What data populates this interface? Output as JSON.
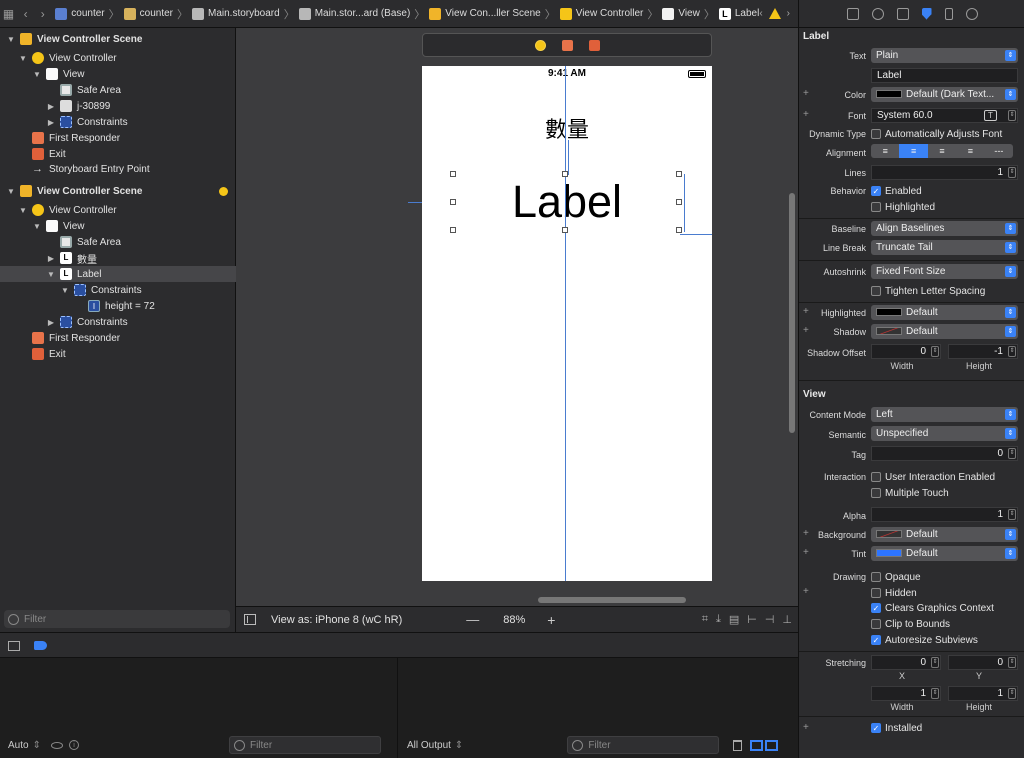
{
  "jumpbar": {
    "crumbs": [
      "counter",
      "counter",
      "Main.storyboard",
      "Main.stor...ard (Base)",
      "View Con...ller Scene",
      "View Controller",
      "View",
      "Label"
    ]
  },
  "outline": {
    "rows": [
      {
        "text": "View Controller Scene",
        "icon": "scene-icon"
      },
      {
        "text": "View Controller",
        "icon": "view-controller-icon"
      },
      {
        "text": "View",
        "icon": "view-icon"
      },
      {
        "text": "Safe Area",
        "icon": "safe-area-icon"
      },
      {
        "text": "j-30899",
        "icon": "image-view-icon"
      },
      {
        "text": "Constraints",
        "icon": "constraints-icon"
      },
      {
        "text": "First Responder",
        "icon": "first-responder-icon"
      },
      {
        "text": "Exit",
        "icon": "exit-icon"
      },
      {
        "text": "Storyboard Entry Point",
        "icon": "entry-point-arrow-icon"
      },
      {
        "text": "View Controller Scene",
        "icon": "scene-icon"
      },
      {
        "text": "View Controller",
        "icon": "view-controller-icon"
      },
      {
        "text": "View",
        "icon": "view-icon"
      },
      {
        "text": "Safe Area",
        "icon": "safe-area-icon"
      },
      {
        "text": "數量",
        "icon": "label-icon"
      },
      {
        "text": "Label",
        "icon": "label-icon"
      },
      {
        "text": "Constraints",
        "icon": "constraints-icon"
      },
      {
        "text": "height = 72",
        "icon": "height-constraint-icon"
      },
      {
        "text": "Constraints",
        "icon": "constraints-icon"
      },
      {
        "text": "First Responder",
        "icon": "first-responder-icon"
      },
      {
        "text": "Exit",
        "icon": "exit-icon"
      }
    ],
    "filter_placeholder": "Filter"
  },
  "canvas": {
    "status_time": "9:41 AM",
    "label_count": "數量",
    "label_main": "Label",
    "view_as": "View as: iPhone 8 (wC hR)",
    "zoom": "88%",
    "zoom_minus": "—",
    "zoom_plus": "+"
  },
  "debug": {
    "auto": "Auto",
    "filter_placeholder": "Filter",
    "all_output": "All Output",
    "console_filter_placeholder": "Filter"
  },
  "inspector": {
    "label_section": "Label",
    "text_label": "Text",
    "text_value": "Plain",
    "text_content": "Label",
    "color_label": "Color",
    "color_value": "Default (Dark Text...",
    "font_label": "Font",
    "font_value": "System 60.0",
    "dynamic_type_label": "Dynamic Type",
    "dynamic_type_value": "Automatically Adjusts Font",
    "alignment_label": "Alignment",
    "lines_label": "Lines",
    "lines_value": "1",
    "behavior_label": "Behavior",
    "enabled": "Enabled",
    "highlighted_chk": "Highlighted",
    "baseline_label": "Baseline",
    "baseline_value": "Align Baselines",
    "line_break_label": "Line Break",
    "line_break_value": "Truncate Tail",
    "autoshrink_label": "Autoshrink",
    "autoshrink_value": "Fixed Font Size",
    "tighten": "Tighten Letter Spacing",
    "highlighted_label": "Highlighted",
    "highlighted_value": "Default",
    "shadow_label": "Shadow",
    "shadow_value": "Default",
    "shadow_offset_label": "Shadow Offset",
    "shadow_w": "0",
    "shadow_h": "-1",
    "width_sub": "Width",
    "height_sub": "Height",
    "view_section": "View",
    "content_mode_label": "Content Mode",
    "content_mode_value": "Left",
    "semantic_label": "Semantic",
    "semantic_value": "Unspecified",
    "tag_label": "Tag",
    "tag_value": "0",
    "interaction_label": "Interaction",
    "user_interaction": "User Interaction Enabled",
    "multiple_touch": "Multiple Touch",
    "alpha_label": "Alpha",
    "alpha_value": "1",
    "background_label": "Background",
    "background_value": "Default",
    "tint_label": "Tint",
    "tint_value": "Default",
    "drawing_label": "Drawing",
    "opaque": "Opaque",
    "hidden": "Hidden",
    "clears_context": "Clears Graphics Context",
    "clip_bounds": "Clip to Bounds",
    "autoresize": "Autoresize Subviews",
    "stretching_label": "Stretching",
    "stretch_x": "0",
    "stretch_y": "0",
    "x_sub": "X",
    "y_sub": "Y",
    "stretch_w": "1",
    "stretch_h": "1",
    "installed": "Installed"
  },
  "colors": {
    "accent": "#3a82f6",
    "warning": "#f5c518",
    "constraint": "#4a7ccf"
  }
}
